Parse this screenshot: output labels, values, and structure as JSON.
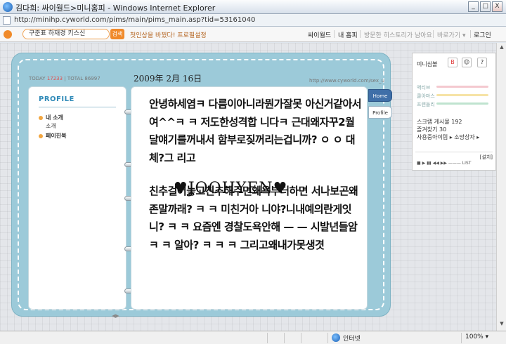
{
  "window": {
    "title": "김다희: 싸이월드>미니홈피 - Windows Internet Explorer",
    "minimize": "_",
    "maximize": "□",
    "close": "X"
  },
  "address": {
    "url": "http://minihp.cyworld.com/pims/main/pims_main.asp?tid=53161040"
  },
  "toolbar": {
    "search_value": "구준표 하재경 키스신",
    "search_button": "검색",
    "notice": "첫인상을 바꿨다! 프로필설정",
    "nav": [
      "싸이월드",
      "내 홈피",
      "방문한 히스토리가 남아요",
      "바로가기 ▾",
      "로그인"
    ]
  },
  "book": {
    "today_label": "TODAY",
    "today_count": "17233",
    "divider": "|",
    "total_label": "TOTAL",
    "total_count": "86997",
    "date": "2009年 2月 16日",
    "site_url": "http://www.cyworld.com/sex_u",
    "profile_title": "PROFILE",
    "menu": [
      "내 소개",
      "소개",
      "페이진북"
    ],
    "pager": "◀▶"
  },
  "post": {
    "text": "안녕하세염ㅋ 다름이아니라뭔가잘못 아신거같아서여^^ㅋ ㅋ 저도한성격합 니다ㅋ 근대왜자꾸2월달얘기를꺼내서 함부로짖꺼리는겁니까? ㅇ ㅇ 대체?그 리고",
    "text2": "친추걸어놓고친추해주면왜욕부터하면 서나보곤왜존말까래? ㅋ ㅋ 미친거아 니야?니내예의란게잇니? ㅋ ㅋ 요즘엔 경찰도욕안해 — — 시발년들암 ㅋ ㅋ 알아? ㅋ ㅋ ㅋ 그리고왜내가못생겻",
    "signature": "♥JOOHYEN♥"
  },
  "tabs": {
    "home": "Home",
    "profile": "Profile"
  },
  "side_panel": {
    "title": "미니심볼",
    "stats": [
      "액티브",
      "쿨아마스",
      "프렌들리"
    ],
    "scrap": "스크랩 게시물 192",
    "favorites": "즐겨찾기 30",
    "items": "사용중아이템 ▸ 소망상자 ▸",
    "player_setting": "[설치]",
    "player_controls": "■ ▶ ▮▮  ◀◀ ▶▶  ——— LIST"
  },
  "status": {
    "zone": "인터넷",
    "zoom": "100% ▾"
  },
  "colors": {
    "book_frame": "#9ccad9",
    "accent_orange": "#f08a2a",
    "profile_blue": "#2f8ab8",
    "home_tab": "#3f6fa8"
  }
}
